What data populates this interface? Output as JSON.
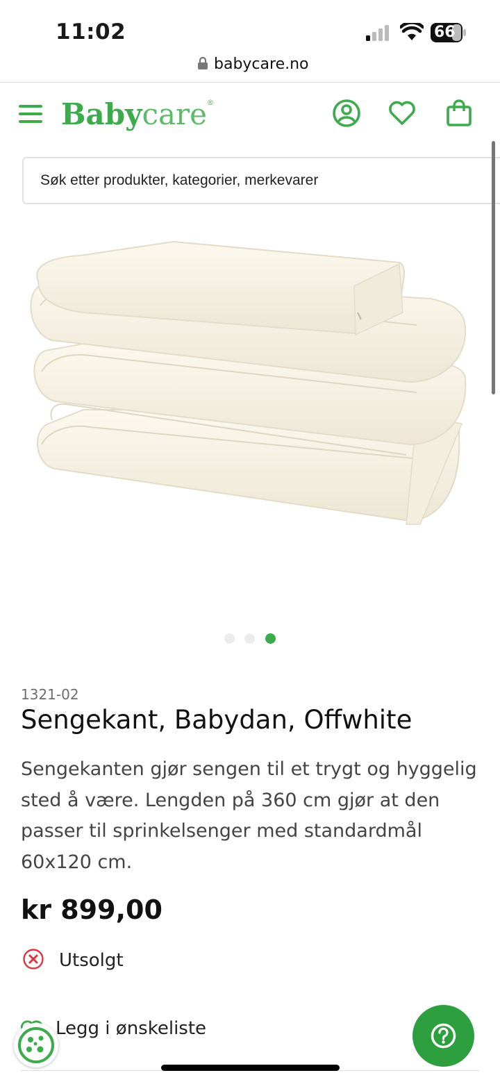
{
  "status": {
    "time": "11:02",
    "battery": "66"
  },
  "browser": {
    "url": "babycare.no"
  },
  "header": {
    "logo_bold": "Baby",
    "logo_light": "care",
    "logo_reg": "®"
  },
  "search": {
    "placeholder": "Søk etter produkter, kategorier, merkevarer"
  },
  "gallery": {
    "total": 3,
    "active_index": 2
  },
  "product": {
    "sku": "1321-02",
    "title": "Sengekant, Babydan, Offwhite",
    "description": "Sengekanten gjør sengen til et trygt og hyggelig sted å være. Lengden på 360 cm  gjør at den passer til sprinkelsenger med standardmål 60x120 cm.",
    "price": "kr 899,00",
    "stock_status": "Utsolgt",
    "wishlist_label": "Legg i ønskeliste"
  },
  "colors": {
    "brand": "#3bab4c",
    "help_button": "#2e9f3e",
    "out_of_stock": "#d9363e"
  },
  "icons": {
    "menu": "hamburger-icon",
    "account": "user-circle-icon",
    "wishlist": "heart-icon",
    "cart": "shopping-bag-icon",
    "stock": "x-circle-icon",
    "help": "question-circle-icon",
    "cookie": "cookie-icon"
  }
}
